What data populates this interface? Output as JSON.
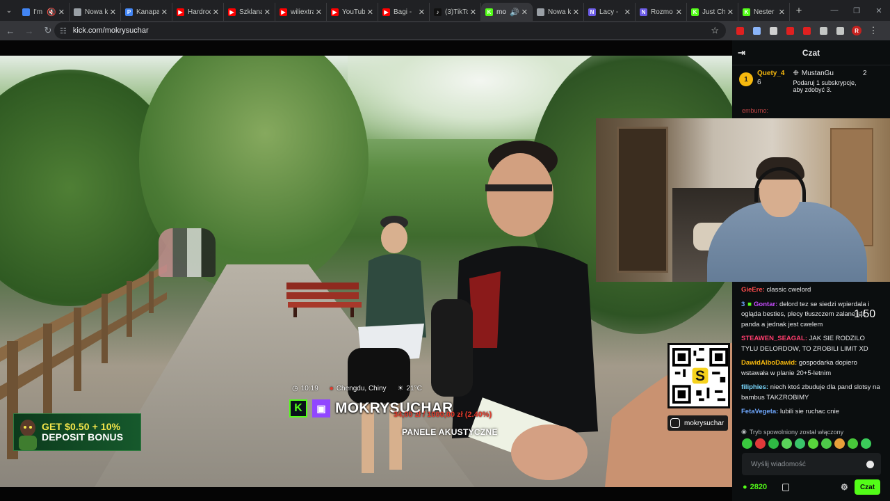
{
  "browser": {
    "tabs": [
      {
        "title": "I'm",
        "icon": "account-icon",
        "color": "#4285f4",
        "active": false,
        "muted": true
      },
      {
        "title": "Nowa k",
        "icon": "chrome-icon",
        "color": "#9aa0a6",
        "active": false
      },
      {
        "title": "Kanapa",
        "icon": "pinterest-icon",
        "color": "#4285f4",
        "active": false
      },
      {
        "title": "Hardrock",
        "icon": "youtube-icon",
        "color": "#ff0000",
        "active": false
      },
      {
        "title": "Szklana",
        "icon": "youtube-icon",
        "color": "#ff0000",
        "active": false
      },
      {
        "title": "wiliextra",
        "icon": "youtube-icon",
        "color": "#ff0000",
        "active": false
      },
      {
        "title": "YouTube",
        "icon": "youtube-icon",
        "color": "#ff0000",
        "active": false
      },
      {
        "title": "Bagi -",
        "icon": "youtube-icon",
        "color": "#ff0000",
        "active": false
      },
      {
        "title": "(3)TikTok",
        "icon": "tiktok-icon",
        "color": "#111111",
        "active": false
      },
      {
        "title": "mo",
        "icon": "kick-icon",
        "color": "#53fc18",
        "active": true,
        "audio": true
      },
      {
        "title": "Nowa k",
        "icon": "chrome-icon",
        "color": "#9aa0a6",
        "active": false
      },
      {
        "title": "Lacy -",
        "icon": "notion-icon",
        "color": "#6c5ce7",
        "active": false
      },
      {
        "title": "Rozmo",
        "icon": "notion-icon",
        "color": "#6c5ce7",
        "active": false
      },
      {
        "title": "Just Ch",
        "icon": "kick-icon",
        "color": "#53fc18",
        "active": false
      },
      {
        "title": "Nester",
        "icon": "kick-icon",
        "color": "#53fc18",
        "active": false
      }
    ],
    "url": "kick.com/mokrysuchar",
    "profile_initial": "R",
    "extensions": [
      {
        "icon": "youtube-ext-icon",
        "color": "#e02020"
      },
      {
        "icon": "translate-ext-icon",
        "color": "#8ab4f8"
      },
      {
        "icon": "mask-ext-icon",
        "color": "#d0d0d0"
      },
      {
        "icon": "red-ext-icon",
        "color": "#e02020"
      },
      {
        "icon": "badge-ext-icon",
        "color": "#e02020"
      },
      {
        "icon": "puzzle-icon",
        "color": "#c4c7c5"
      },
      {
        "icon": "media-queue-icon",
        "color": "#c4c7c5"
      }
    ]
  },
  "stream": {
    "promo": {
      "line1": "GET $0.50 + 10%",
      "line2": "DEPOSIT BONUS"
    },
    "time": "10:19",
    "location": "Chengdu, Chiny",
    "temp": "21°C",
    "streamer": "MOKRYSUCHAR",
    "money": "34,00 zł / 1000,00 zł (2.40%)",
    "sponsor_text": "PANELE AKUSTYCZNE",
    "qr_letter": "S",
    "instagram": "mokrysuchar",
    "timer_overlay": "1:50"
  },
  "chat": {
    "title": "Czat",
    "leaders": [
      {
        "rank": "1",
        "name": "Quety_4",
        "count": "6"
      },
      {
        "name": "MustanGu",
        "count": "2"
      }
    ],
    "gift_text": "Podaruj 1 subskrypcje, aby zdobyć 3.",
    "pinned_user": "emburno:",
    "messages": [
      {
        "user": "GieEre:",
        "color": "#ff4d4d",
        "text": "classic cwelord"
      },
      {
        "user": "Gontar:",
        "color": "#c84dff",
        "badge": "3",
        "text": "delord tez se siedzi wpierdala i ogląda besties, plecy tłuszczem zalane jak panda a jednak jest cwelem"
      },
      {
        "user": "STEAWEN_SEAGAL:",
        "color": "#ff3d6e",
        "text": "JAK SIE RODZILO TYLU DELORDOW, TO ZROBILI LIMIT XD"
      },
      {
        "user": "DawidAlboDawid:",
        "color": "#f6b80e",
        "text": "gospodarka dopiero wstawała w planie 20+5-letnim"
      },
      {
        "user": "filiphies:",
        "color": "#7bd9ff",
        "text": "niech ktoś zbuduje dla pand slotsy na bambus TAKZROBIMY"
      },
      {
        "user": "FetaVegeta:",
        "color": "#6fa8ff",
        "text": "lubili sie ruchac cnie"
      }
    ],
    "slow_mode": "Tryb spowolniony został włączony",
    "input_placeholder": "Wyślij wiadomość",
    "points": "2820",
    "send_label": "Czat",
    "emote_colors": [
      "#3ac93f",
      "#e03a3a",
      "#2fb844",
      "#5ad35a",
      "#39c46a",
      "#58d63c",
      "#4ec94a",
      "#e6a03a",
      "#48c83a",
      "#3bcc5a"
    ]
  }
}
